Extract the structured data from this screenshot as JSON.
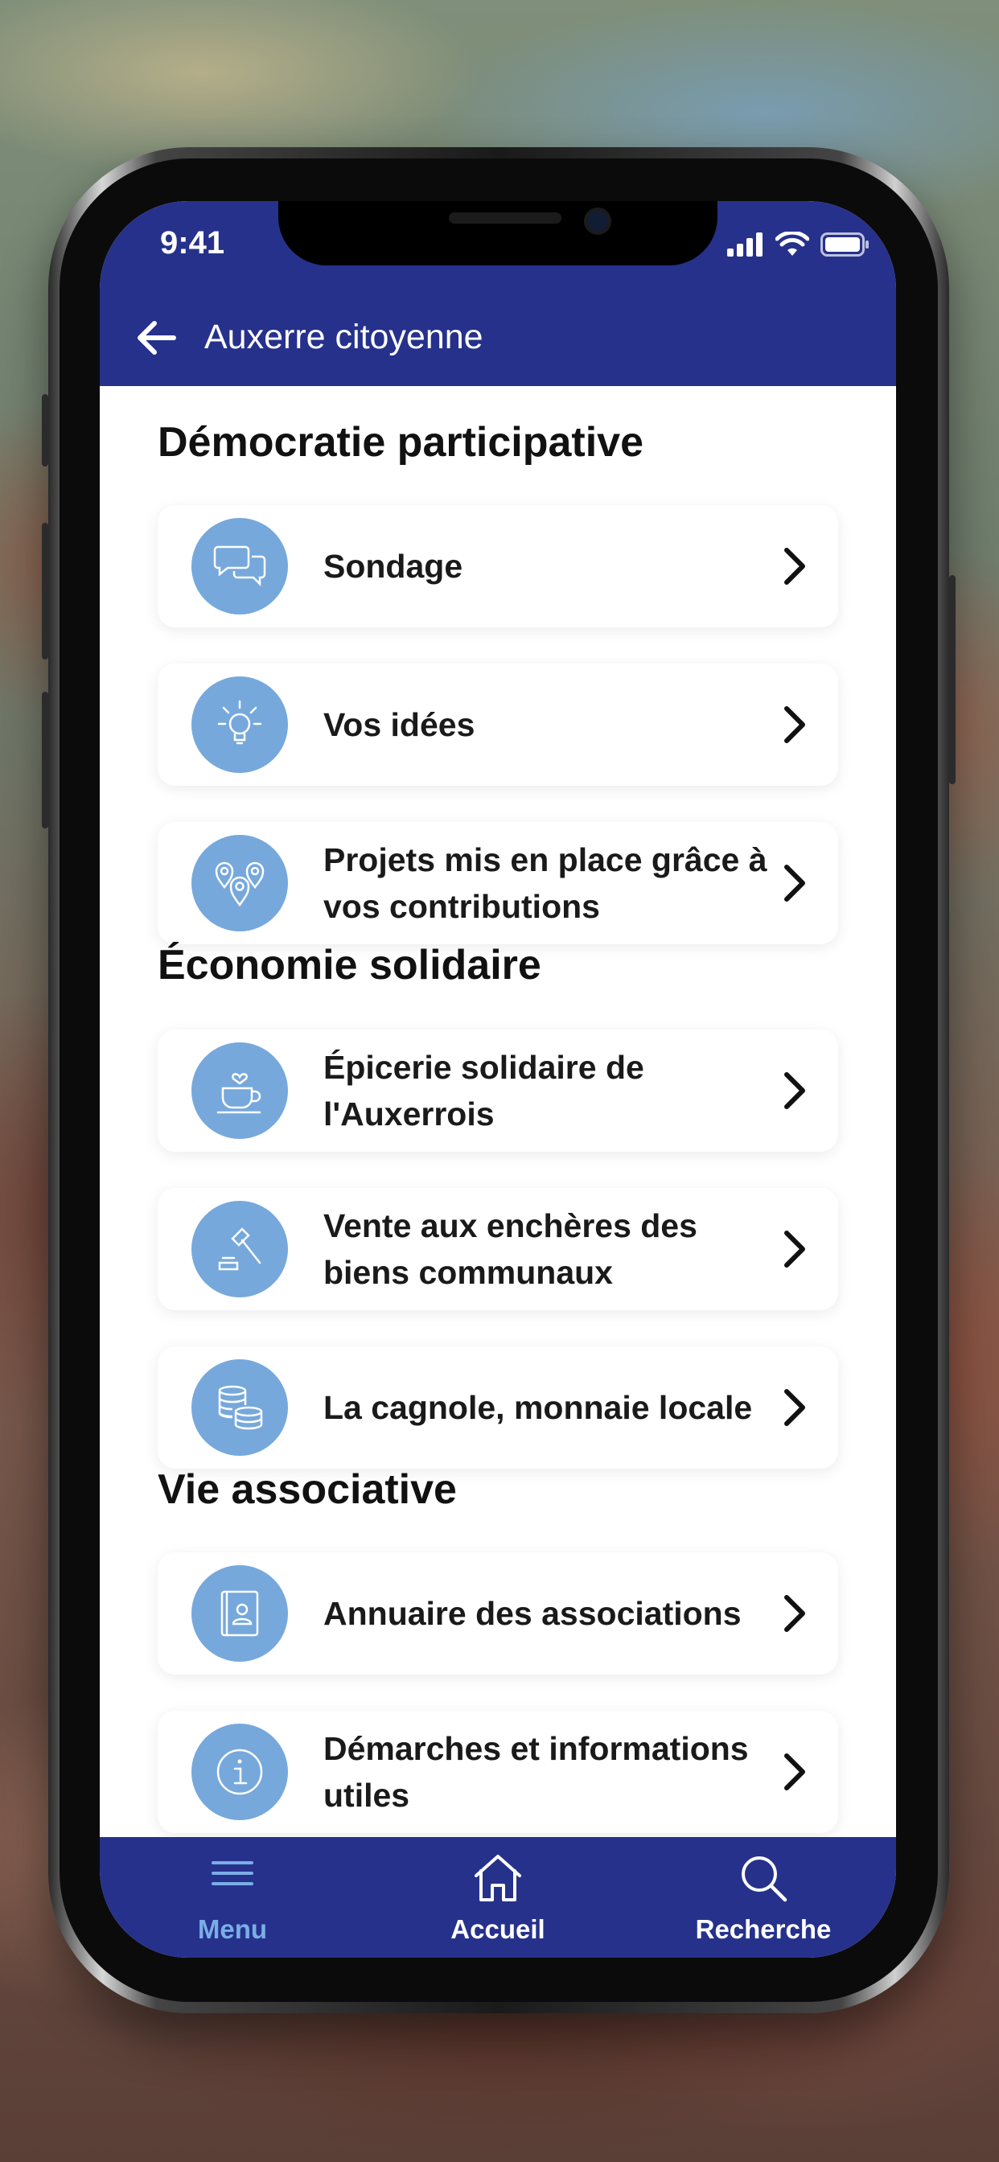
{
  "status_bar": {
    "time": "9:41"
  },
  "header": {
    "title": "Auxerre citoyenne",
    "back_icon": "arrow-left-icon"
  },
  "sections": [
    {
      "title": "Démocratie participative",
      "items": [
        {
          "label": "Sondage",
          "icon": "chat-bubbles-icon"
        },
        {
          "label": "Vos idées",
          "icon": "lightbulb-icon"
        },
        {
          "label": "Projets mis en place grâce à vos contributions",
          "icon": "map-pins-icon"
        }
      ]
    },
    {
      "title": "Économie solidaire",
      "items": [
        {
          "label": "Épicerie solidaire de l'Auxerrois",
          "icon": "cup-heart-icon"
        },
        {
          "label": "Vente aux enchères des biens communaux",
          "icon": "gavel-icon"
        },
        {
          "label": "La cagnole, monnaie locale",
          "icon": "coins-icon"
        }
      ]
    },
    {
      "title": "Vie associative",
      "items": [
        {
          "label": "Annuaire des associations",
          "icon": "address-book-icon"
        },
        {
          "label": "Démarches et informations utiles",
          "icon": "info-icon"
        }
      ]
    }
  ],
  "tabbar": {
    "menu": "Menu",
    "home": "Accueil",
    "search": "Recherche",
    "active": "Menu"
  },
  "colors": {
    "primary": "#26318c",
    "icon_circle": "#76a8dc",
    "active_tab": "#7aaee6"
  }
}
